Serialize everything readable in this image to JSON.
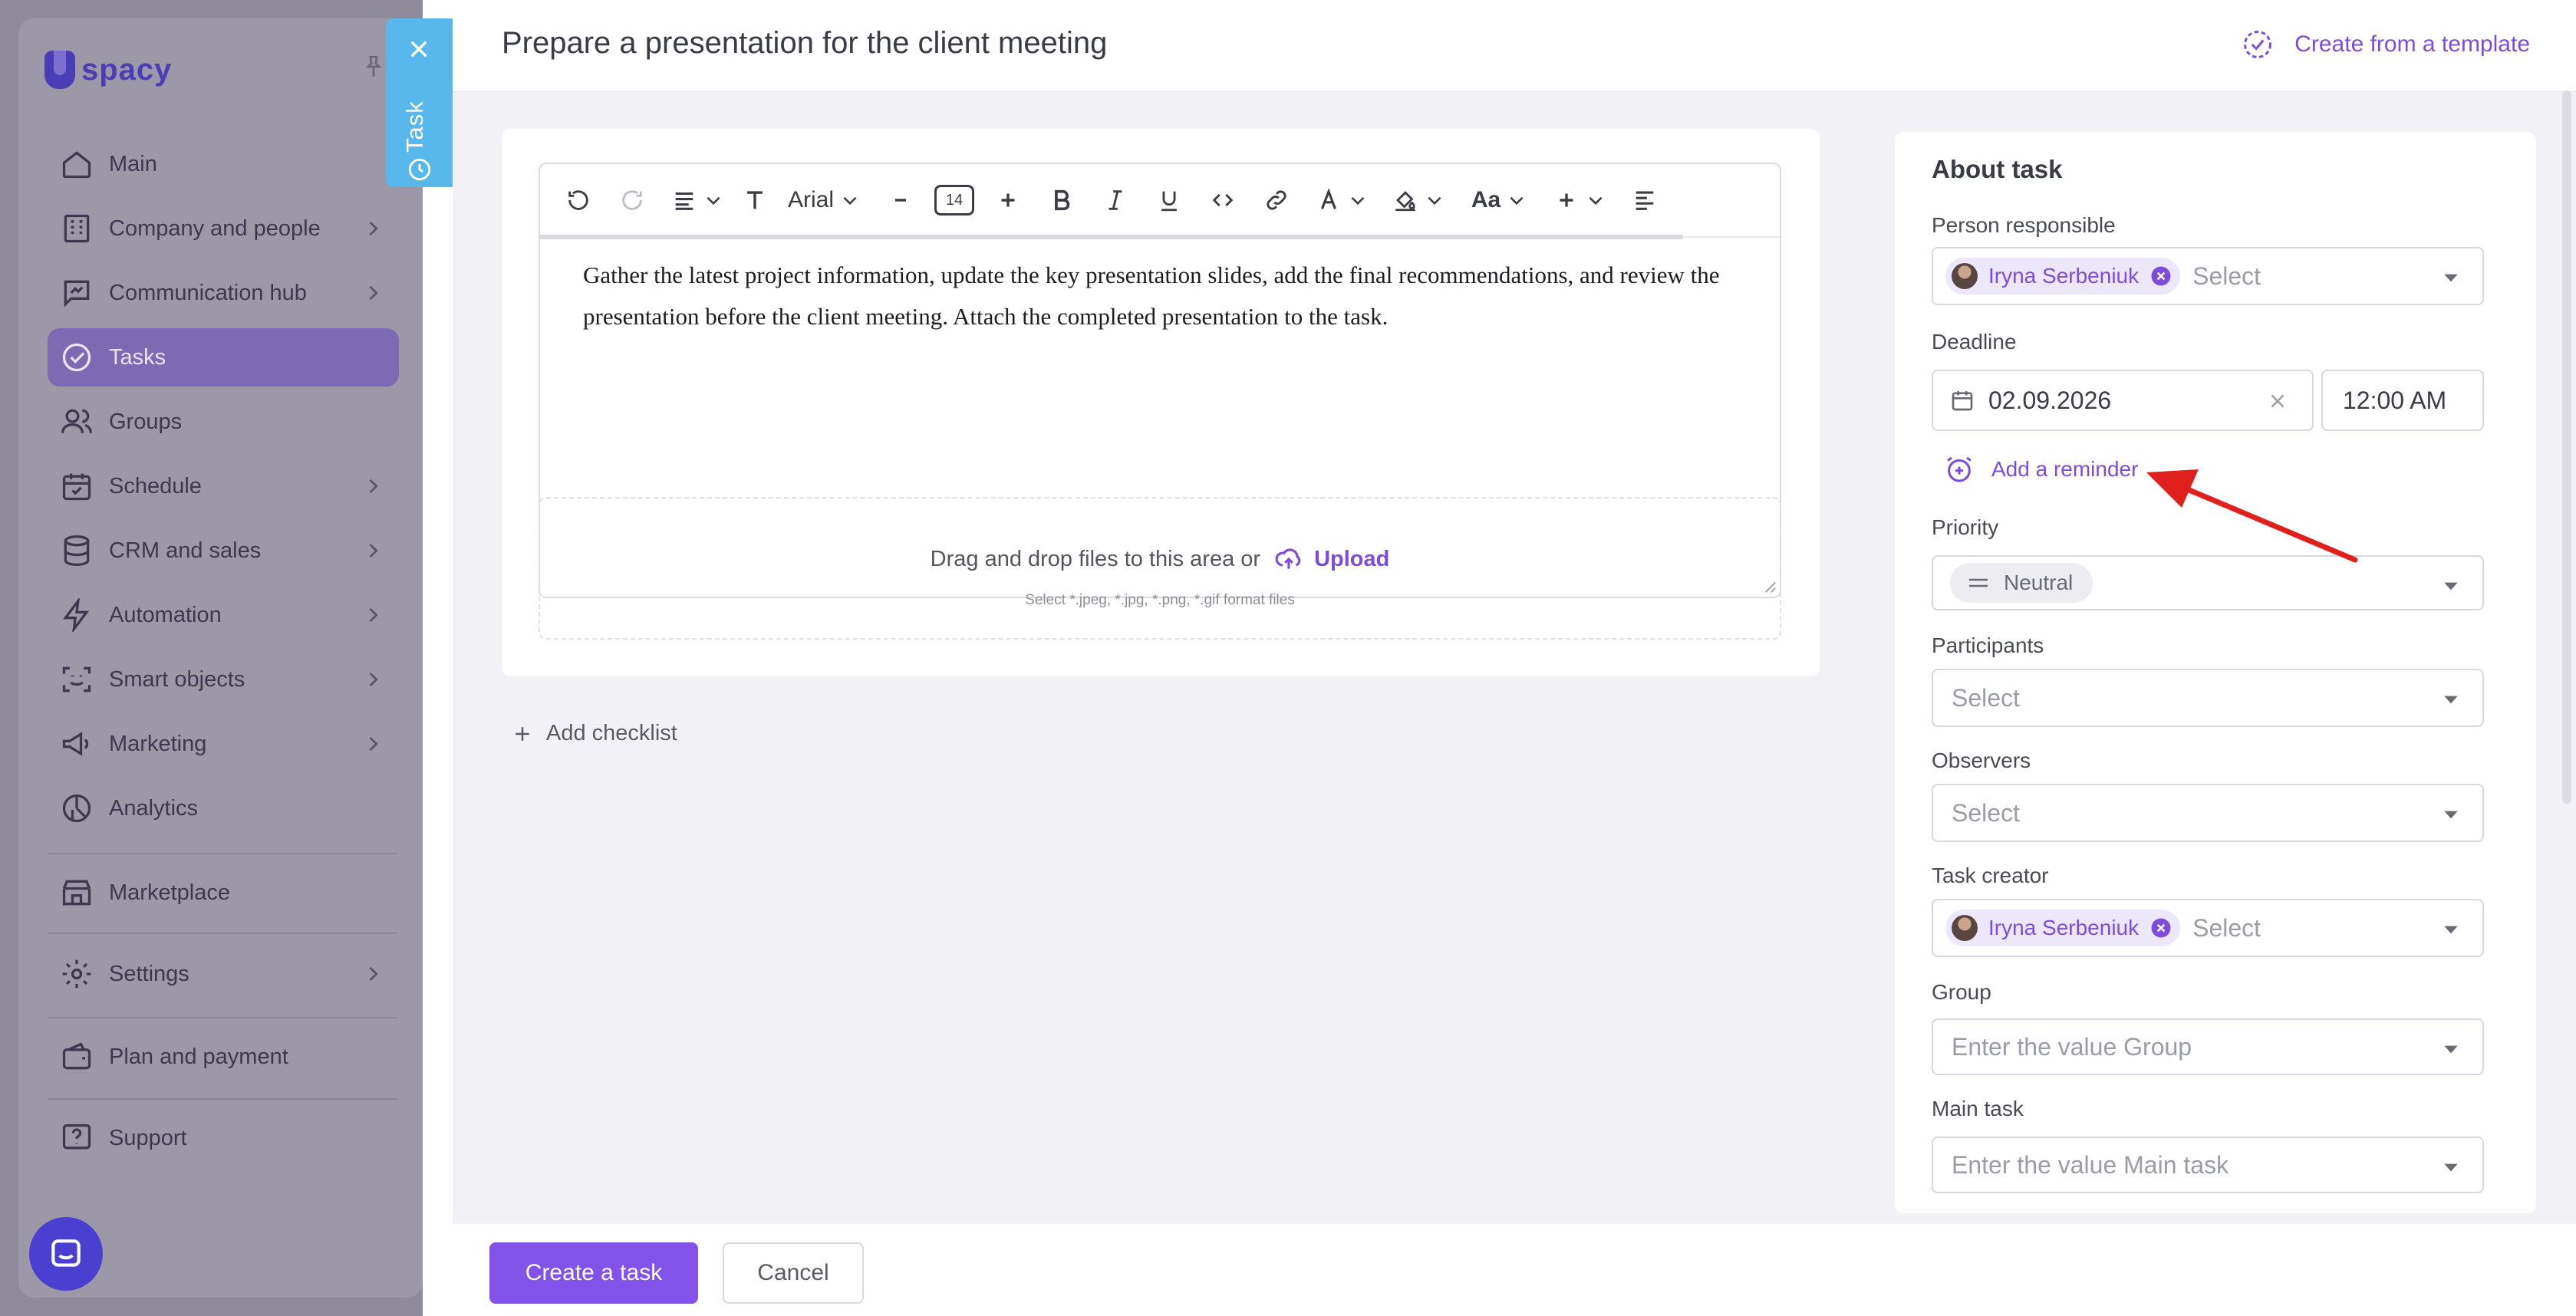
{
  "sidebar": {
    "logo_text": "spacy",
    "items": [
      {
        "label": "Main",
        "icon": "home-icon"
      },
      {
        "label": "Company and people",
        "icon": "building-icon"
      },
      {
        "label": "Communication hub",
        "icon": "chat-icon"
      },
      {
        "label": "Tasks",
        "icon": "check-circle-icon"
      },
      {
        "label": "Groups",
        "icon": "people-icon"
      },
      {
        "label": "Schedule",
        "icon": "calendar-icon"
      },
      {
        "label": "CRM and sales",
        "icon": "database-icon"
      },
      {
        "label": "Automation",
        "icon": "lightning-icon"
      },
      {
        "label": "Smart objects",
        "icon": "scan-face-icon"
      },
      {
        "label": "Marketing",
        "icon": "megaphone-icon"
      },
      {
        "label": "Analytics",
        "icon": "pie-chart-icon"
      },
      {
        "label": "Marketplace",
        "icon": "store-icon"
      },
      {
        "label": "Settings",
        "icon": "gear-icon"
      },
      {
        "label": "Plan and payment",
        "icon": "wallet-icon"
      },
      {
        "label": "Support",
        "icon": "help-icon"
      }
    ]
  },
  "task_tab": {
    "label": "Task"
  },
  "header": {
    "title": "Prepare a presentation for the client meeting",
    "template_link": "Create from a template"
  },
  "editor": {
    "font_name": "Arial",
    "font_size": "14",
    "case_label": "Aa",
    "body": "Gather the latest project information, update the key presentation slides, add the final recommendations, and review the presentation before the client meeting. Attach the completed presentation to the task."
  },
  "dropzone": {
    "text": "Drag and drop files to this area or",
    "upload": "Upload",
    "hint": "Select *.jpeg, *.jpg, *.png, *.gif format files"
  },
  "add_checklist": "Add checklist",
  "about": {
    "title": "About task",
    "person_responsible": {
      "label": "Person responsible",
      "chip": "Iryna Serbeniuk",
      "placeholder": "Select"
    },
    "deadline": {
      "label": "Deadline",
      "date": "02.09.2026",
      "time": "12:00 AM"
    },
    "reminder": "Add a reminder",
    "priority": {
      "label": "Priority",
      "value": "Neutral"
    },
    "participants": {
      "label": "Participants",
      "placeholder": "Select"
    },
    "observers": {
      "label": "Observers",
      "placeholder": "Select"
    },
    "task_creator": {
      "label": "Task creator",
      "chip": "Iryna Serbeniuk",
      "placeholder": "Select"
    },
    "group": {
      "label": "Group",
      "placeholder": "Enter the value Group"
    },
    "main_task": {
      "label": "Main task",
      "placeholder": "Enter the value Main task"
    }
  },
  "footer": {
    "create": "Create a task",
    "cancel": "Cancel"
  },
  "colors": {
    "accent": "#8352e8",
    "link": "#7c4ddb",
    "task_tab": "#58b8ec",
    "annotation_arrow": "#e0201c"
  }
}
